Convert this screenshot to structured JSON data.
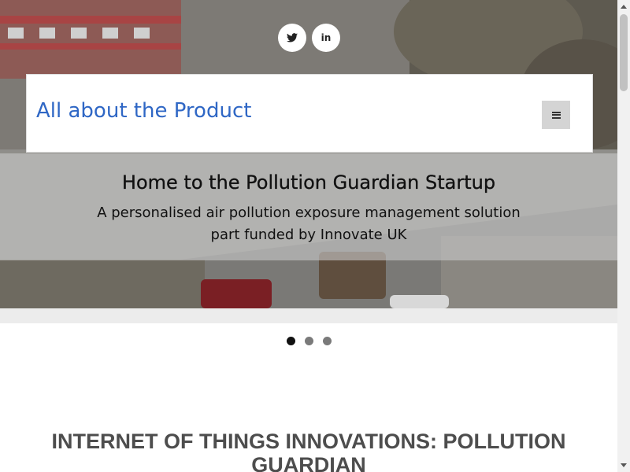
{
  "social": [
    {
      "icon": "twitter-icon",
      "glyph": "🐦"
    },
    {
      "icon": "linkedin-icon",
      "glyph": "in"
    }
  ],
  "header": {
    "brand": "All about the Product",
    "menu_icon": "hamburger-icon"
  },
  "hero": {
    "title": "Home to the Pollution Guardian Startup",
    "subtitle_line1": "A personalised air pollution exposure management solution",
    "subtitle_line2": "part funded by Innovate UK"
  },
  "carousel": {
    "slide_count": 3,
    "active_index": 0
  },
  "section": {
    "title": "INTERNET OF THINGS INNOVATIONS: POLLUTION GUARDIAN"
  },
  "colors": {
    "brand": "#2f67c5",
    "section_title": "#4d4d4d"
  }
}
